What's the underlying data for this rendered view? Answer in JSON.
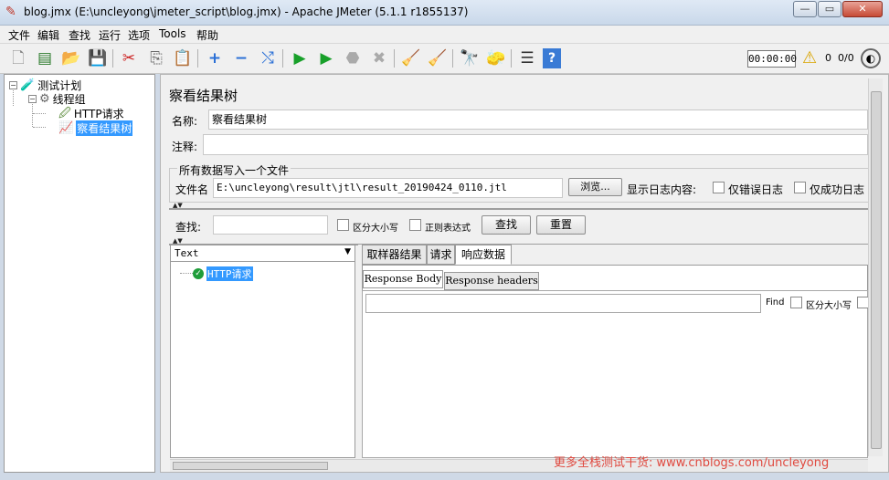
{
  "window": {
    "title": "blog.jmx (E:\\uncleyong\\jmeter_script\\blog.jmx) - Apache JMeter (5.1.1 r1855137)",
    "min_symbol": "—",
    "max_symbol": "▭",
    "close_symbol": "✕"
  },
  "menu": [
    "文件",
    "编辑",
    "查找",
    "运行",
    "选项",
    "Tools",
    "帮助"
  ],
  "toolbar": {
    "icons": [
      "new-icon",
      "templates-icon",
      "open-icon",
      "save-icon",
      "cut-icon",
      "copy-icon",
      "paste-icon",
      "expand-icon",
      "collapse-icon",
      "toggle-icon",
      "start-icon",
      "start-no-pause-icon",
      "stop-icon",
      "shutdown-icon",
      "clear-icon",
      "clear-all-icon",
      "search-icon",
      "reset-search-icon",
      "function-helper-icon",
      "help-icon"
    ],
    "timer": "00:00:00",
    "warning_count": "0",
    "threads": "0/0"
  },
  "tree": {
    "test_plan": "测试计划",
    "thread_group": "线程组",
    "http_request": "HTTP请求",
    "view_results_tree": "察看结果树"
  },
  "panel": {
    "title": "察看结果树",
    "name_label": "名称:",
    "name_value": "察看结果树",
    "comment_label": "注释:",
    "comment_value": "",
    "write_all_label": "所有数据写入一个文件",
    "filename_label": "文件名",
    "filename_value": "E:\\uncleyong\\result\\jtl\\result_20190424_0110.jtl",
    "browse_button": "浏览...",
    "log_display_label": "显示日志内容:",
    "errors_only": "仅错误日志",
    "success_only": "仅成功日志",
    "search_label": "查找:",
    "search_value": "",
    "case_sensitive": "区分大小写",
    "regex": "正则表达式",
    "search_button": "查找",
    "reset_button": "重置"
  },
  "results": {
    "renderer": "Text",
    "items": [
      "HTTP请求"
    ],
    "tabs": [
      "取样器结果",
      "请求",
      "响应数据"
    ],
    "active_tab": "响应数据",
    "subtabs": [
      "Response Body",
      "Response headers"
    ],
    "find_label": "Find",
    "find_case": "区分大小写"
  },
  "watermark": "更多全栈测试干货: www.cnblogs.com/uncleyong"
}
